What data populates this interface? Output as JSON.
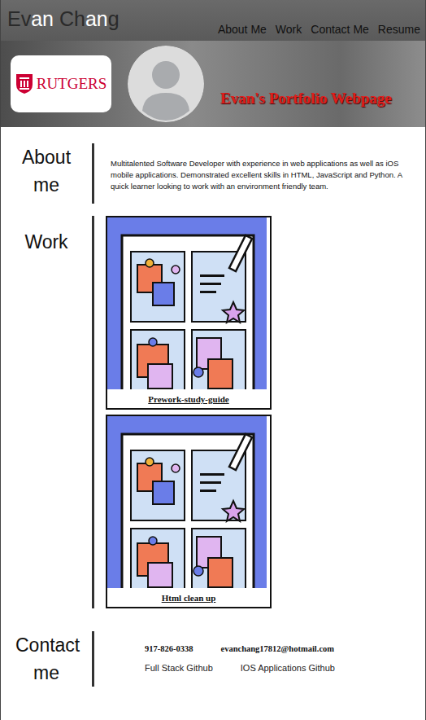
{
  "header": {
    "logo": [
      {
        "text": "Ev",
        "highlight": false
      },
      {
        "text": "an",
        "highlight": true
      },
      {
        "text": " Ch",
        "highlight": false
      },
      {
        "text": "an",
        "highlight": true
      },
      {
        "text": "g",
        "highlight": false
      }
    ],
    "nav": [
      "About Me",
      "Work",
      "Contact Me",
      "Resume"
    ]
  },
  "hero": {
    "school_logo": "RUTGERS",
    "title": "Evan's Portfolio Webpage"
  },
  "about": {
    "heading": "About me",
    "text": "Multitalented Software Developer with experience in web applications as well as iOS mobile applications. Demonstrated excellent skills in HTML, JavaScript and Python. A quick learner looking to work with an environment friendly team."
  },
  "work": {
    "heading": "Work",
    "projects": [
      {
        "title": "Prework-study-guide"
      },
      {
        "title": "Html clean up"
      }
    ]
  },
  "contact": {
    "heading": "Contact me",
    "phone": "917-826-0338",
    "email": "evanchang17812@hotmail.com",
    "links": [
      "Full Stack Github",
      "IOS Applications Github"
    ]
  }
}
